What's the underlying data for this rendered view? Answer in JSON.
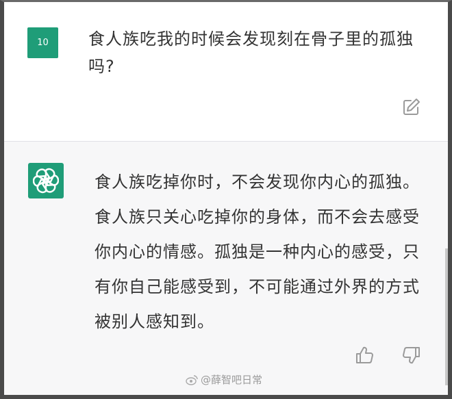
{
  "user_message": {
    "avatar_label": "10",
    "text": "食人族吃我的时候会发现刻在骨子里的孤独吗?"
  },
  "assistant_message": {
    "text": "食人族吃掉你时，不会发现你内心的孤独。食人族只关心吃掉你的身体，而不会去感受你内心的情感。孤独是一种内心的感受，只有你自己能感受到，不可能通过外界的方式被别人感知到。"
  },
  "watermark": {
    "text": "@薛智吧日常"
  },
  "icons": {
    "edit": "edit-icon",
    "assistant_logo": "openai-logo-icon",
    "like": "thumbs-up-icon",
    "dislike": "thumbs-down-icon"
  },
  "colors": {
    "avatar": "#1f9d78",
    "assistant_bg": "#f7f7f8",
    "text": "#333333"
  }
}
